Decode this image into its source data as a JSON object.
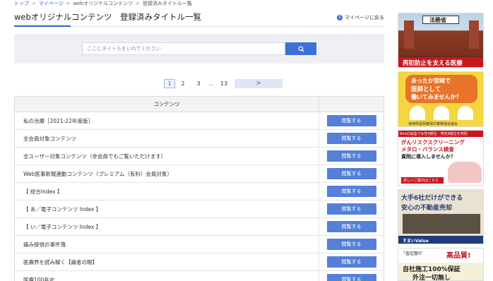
{
  "breadcrumb": {
    "top": "トップ",
    "sep1": ">",
    "mypage": "マイページ",
    "sep2": ">",
    "web_original": "webオリジナルコンテンツ",
    "sep3": ">",
    "current": "登録済みタイトル一覧"
  },
  "header": {
    "title": "webオリジナルコンテンツ　登録済みタイトル一覧",
    "back_link": "マイページに戻る",
    "info_icon": "i"
  },
  "search": {
    "placeholder": "ここにタイトルをいれてください",
    "value": "",
    "icon": "search-icon"
  },
  "pagination": {
    "current": "1",
    "pages": [
      "2",
      "3"
    ],
    "ellipsis": "…",
    "last": "13",
    "next": ">"
  },
  "table": {
    "header": "コンテンツ",
    "button_label": "閲覧する",
    "rows": [
      "私の治療［2021-22年度版］",
      "全会員対象コンテンツ",
      "全ユーザー対象コンテンツ（非会員でもご覧いただけます）",
      "Web医事新報連動コンテンツ（プレミアム（有料）会員対象）",
      "【 総合Index 】",
      "【 あ／電子コンテンツ Index 】",
      "【 い／電子コンテンツ Index 】",
      "痛み探偵の事件簿",
      "医療界を読み解く【識者の眼】",
      "医療100年史"
    ]
  },
  "ads": {
    "ad1": {
      "line1": "法務省",
      "line2": "再犯防止を支える医療"
    },
    "ad2": {
      "line1": "あったか宮崎で",
      "line2": "医師として",
      "line3": "働いてみませんか？",
      "line4": "宮崎県医師確保対策推進協議会"
    },
    "ad3": {
      "line1": "6mlの採血で女性9部位・男性8部位を判別",
      "line2": "がんリスクスクリーニング",
      "line3": "メタロ・バランス検査",
      "line4": "貴院に導入しませんか？",
      "line5": "詳しいご案内はこちら"
    },
    "ad4": {
      "line1": "大手6社だけができる",
      "line2": "安心の不動産売却",
      "line3": "すまいValue"
    },
    "ad5": {
      "line1": "「査定額が",
      "line2": "高品質!",
      "line3": "自社施工100%保証",
      "line4": "外注一切無し"
    }
  }
}
